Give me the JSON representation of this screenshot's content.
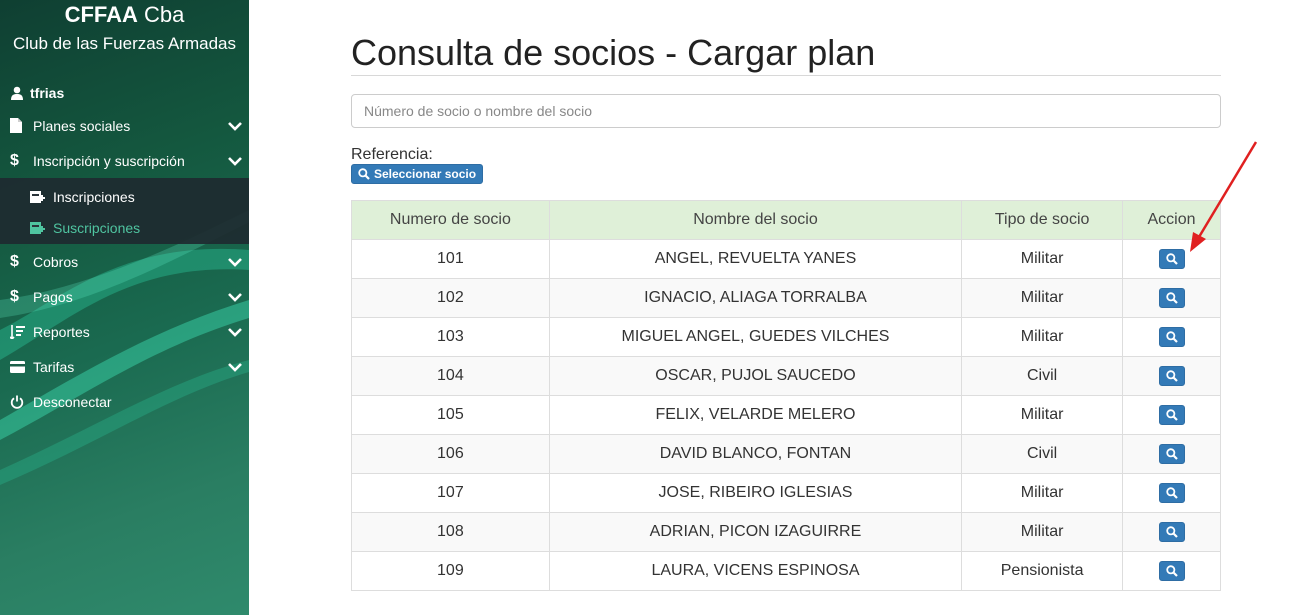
{
  "sidebar": {
    "brand_bold": "CFFAA",
    "brand_rest": " Cba",
    "brand_subtitle": "Club de las Fuerzas Armadas",
    "user": "tfrias",
    "items": [
      {
        "label": "Planes sociales",
        "icon": "file-icon"
      },
      {
        "label": "Inscripción y suscripción",
        "icon": "dollar-icon"
      },
      {
        "label": "Cobros",
        "icon": "dollar-icon"
      },
      {
        "label": "Pagos",
        "icon": "dollar-icon"
      },
      {
        "label": "Reportes",
        "icon": "list-icon"
      },
      {
        "label": "Tarifas",
        "icon": "card-icon"
      },
      {
        "label": "Desconectar",
        "icon": "power-icon"
      }
    ],
    "submenu": [
      {
        "label": "Inscripciones",
        "icon": "calendar-icon"
      },
      {
        "label": "Suscripciones",
        "icon": "calendar-icon"
      }
    ]
  },
  "main": {
    "title": "Consulta de socios - Cargar plan",
    "search_placeholder": "Número de socio o nombre del socio",
    "reference_label": "Referencia:",
    "select_button": "Seleccionar socio"
  },
  "table": {
    "headers": [
      "Numero de socio",
      "Nombre del socio",
      "Tipo de socio",
      "Accion"
    ],
    "rows": [
      {
        "num": "101",
        "name": "ANGEL, REVUELTA YANES",
        "type": "Militar"
      },
      {
        "num": "102",
        "name": "IGNACIO, ALIAGA TORRALBA",
        "type": "Militar"
      },
      {
        "num": "103",
        "name": "MIGUEL ANGEL, GUEDES VILCHES",
        "type": "Militar"
      },
      {
        "num": "104",
        "name": "OSCAR, PUJOL SAUCEDO",
        "type": "Civil"
      },
      {
        "num": "105",
        "name": "FELIX, VELARDE MELERO",
        "type": "Militar"
      },
      {
        "num": "106",
        "name": "DAVID BLANCO, FONTAN",
        "type": "Civil"
      },
      {
        "num": "107",
        "name": "JOSE, RIBEIRO IGLESIAS",
        "type": "Militar"
      },
      {
        "num": "108",
        "name": "ADRIAN, PICON IZAGUIRRE",
        "type": "Militar"
      },
      {
        "num": "109",
        "name": "LAURA, VICENS ESPINOSA",
        "type": "Pensionista"
      }
    ]
  },
  "colors": {
    "accent": "#337ab7",
    "header_bg": "#dff0d8",
    "sidebar_active": "#4fc4a0",
    "annotation_arrow": "#e02020"
  }
}
